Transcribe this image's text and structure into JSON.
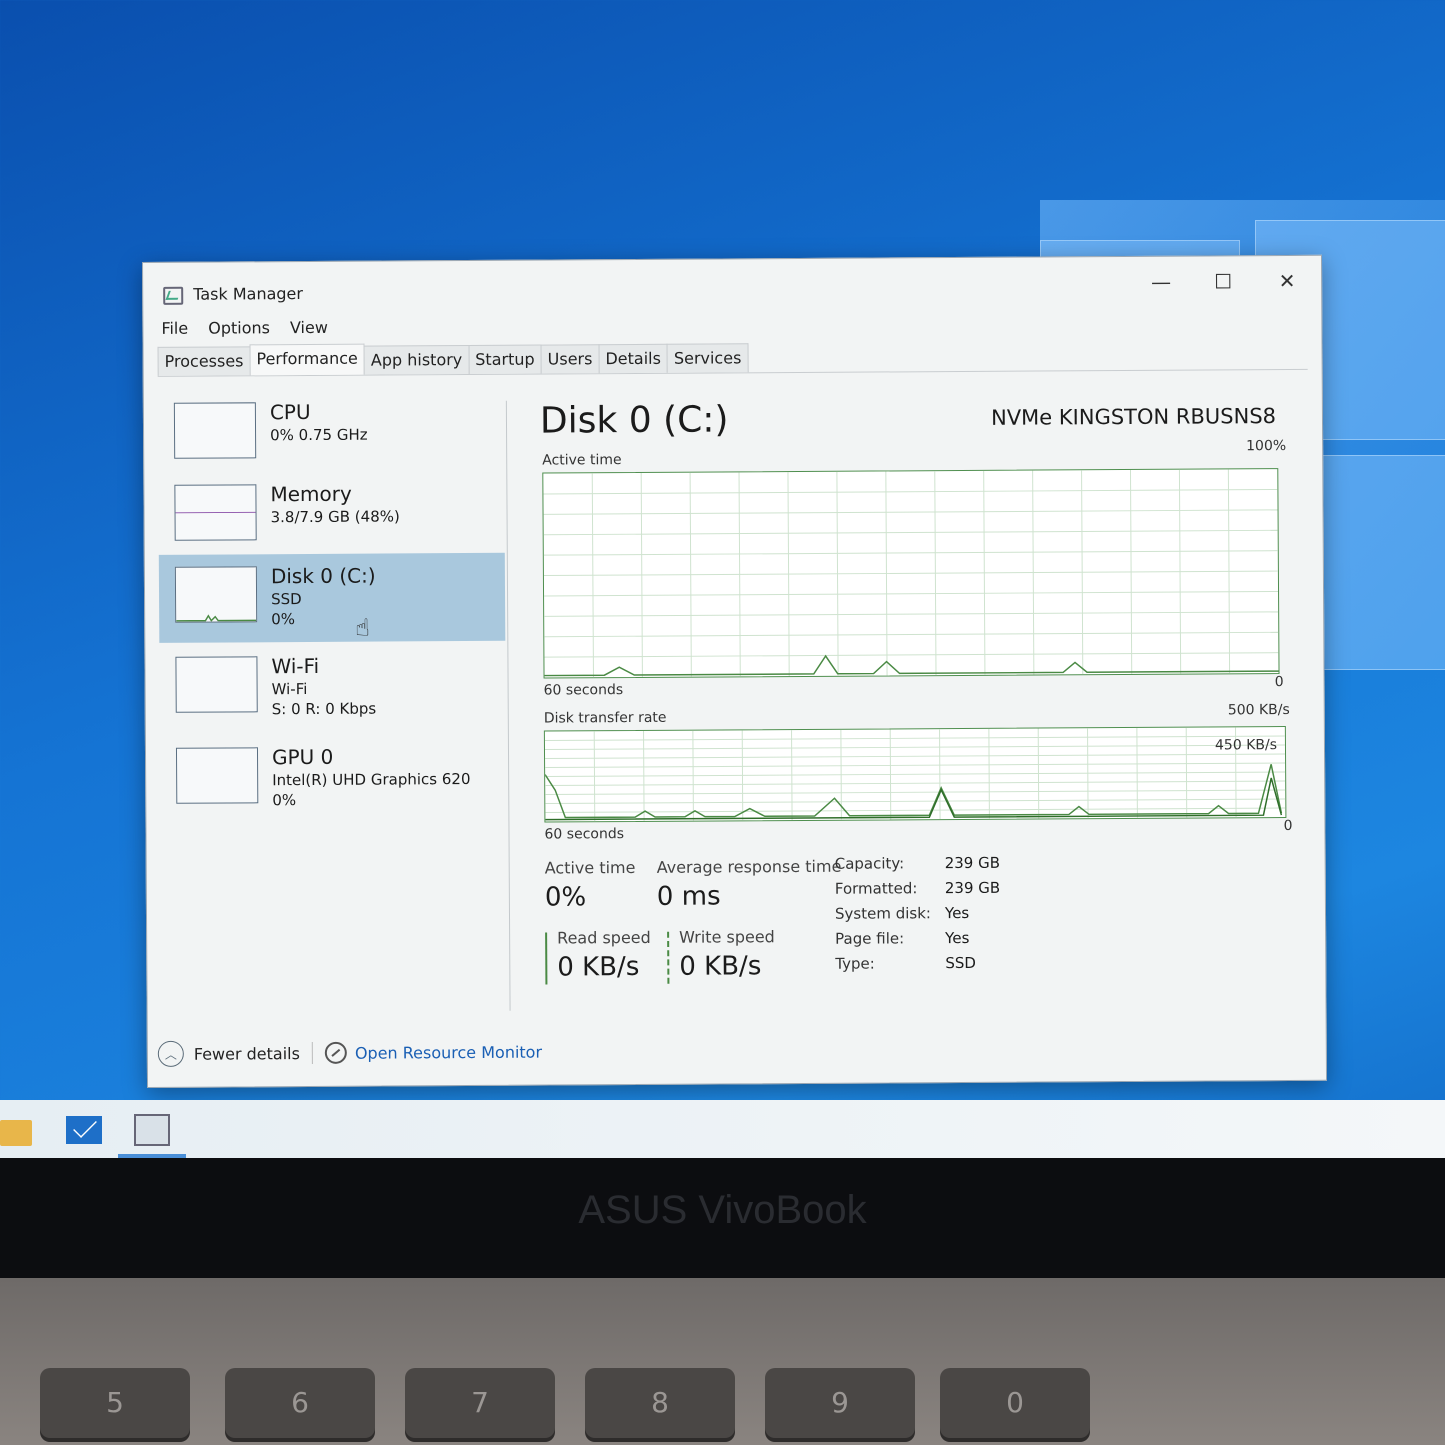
{
  "window": {
    "title": "Task Manager",
    "minimize": "—",
    "maximize": "☐",
    "close": "✕"
  },
  "menu": [
    "File",
    "Options",
    "View"
  ],
  "tabs": [
    "Processes",
    "Performance",
    "App history",
    "Startup",
    "Users",
    "Details",
    "Services"
  ],
  "active_tab": "Performance",
  "sidebar": [
    {
      "name": "CPU",
      "line2": "0% 0.75 GHz",
      "line3": ""
    },
    {
      "name": "Memory",
      "line2": "3.8/7.9 GB (48%)",
      "line3": ""
    },
    {
      "name": "Disk 0 (C:)",
      "line2": "SSD",
      "line3": "0%"
    },
    {
      "name": "Wi-Fi",
      "line2": "Wi-Fi",
      "line3": "S: 0 R: 0 Kbps"
    },
    {
      "name": "GPU 0",
      "line2": "Intel(R) UHD Graphics 620",
      "line3": "0%"
    }
  ],
  "selected_item": "Disk 0 (C:)",
  "detail": {
    "title": "Disk 0 (C:)",
    "model": "NVMe KINGSTON RBUSNS8",
    "graph1": {
      "label": "Active time",
      "max": "100%",
      "time": "60 seconds",
      "min": "0"
    },
    "graph2": {
      "label": "Disk transfer rate",
      "max": "500 KB/s",
      "inner": "450 KB/s",
      "time": "60 seconds",
      "min": "0"
    },
    "stats": {
      "active_time_label": "Active time",
      "active_time_value": "0%",
      "avg_resp_label": "Average response time",
      "avg_resp_value": "0 ms",
      "read_label": "Read speed",
      "read_value": "0 KB/s",
      "write_label": "Write speed",
      "write_value": "0 KB/s"
    },
    "properties": [
      {
        "key": "Capacity:",
        "value": "239 GB"
      },
      {
        "key": "Formatted:",
        "value": "239 GB"
      },
      {
        "key": "System disk:",
        "value": "Yes"
      },
      {
        "key": "Page file:",
        "value": "Yes"
      },
      {
        "key": "Type:",
        "value": "SSD"
      }
    ]
  },
  "footer": {
    "fewer_details": "Fewer details",
    "resource_monitor": "Open Resource Monitor"
  },
  "laptop_brand": "ASUS VivoBook",
  "keyboard_keys": [
    "5",
    "6",
    "7",
    "8",
    "9",
    "0"
  ],
  "colors": {
    "accent": "#1a5fb4",
    "graph_line": "#4a8a44",
    "selected": "#a9c8dd"
  }
}
